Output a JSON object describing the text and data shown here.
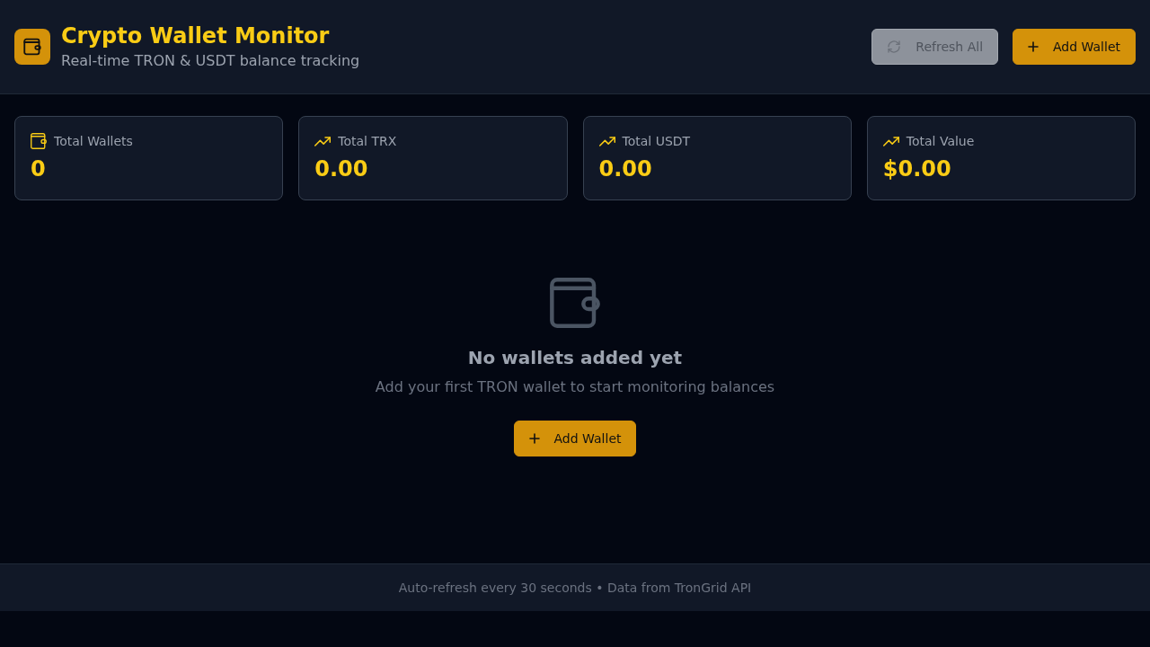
{
  "header": {
    "title": "Crypto Wallet Monitor",
    "subtitle": "Real-time TRON & USDT balance tracking",
    "actions": [
      {
        "kind": "refresh",
        "label": "Refresh All",
        "disabled": true
      },
      {
        "kind": "add",
        "label": "Add Wallet",
        "disabled": false
      }
    ]
  },
  "stats": [
    {
      "kind": "wallets",
      "label": "Total Wallets",
      "value": "0"
    },
    {
      "kind": "trend",
      "label": "Total TRX",
      "value": "0.00"
    },
    {
      "kind": "trend",
      "label": "Total USDT",
      "value": "0.00"
    },
    {
      "kind": "trend",
      "label": "Total Value",
      "value": "$0.00"
    }
  ],
  "empty_state": {
    "title": "No wallets added yet",
    "message": "Add your first TRON wallet to start monitoring balances",
    "action": {
      "kind": "add",
      "label": "Add Wallet",
      "disabled": false
    }
  },
  "footer": {
    "text": "Auto-refresh every 30 seconds • Data from TronGrid API"
  }
}
